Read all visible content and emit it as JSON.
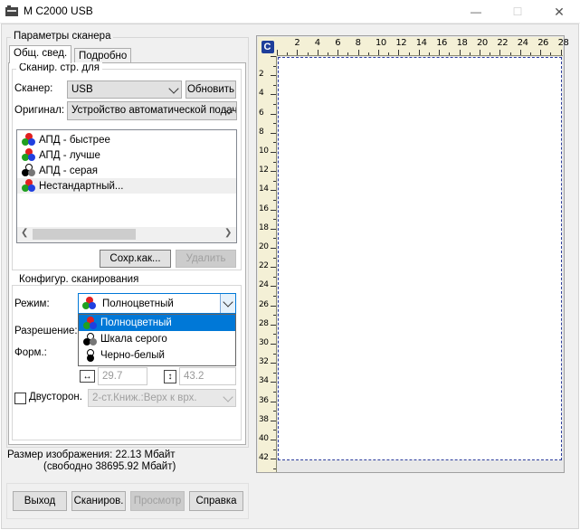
{
  "window": {
    "title": "M C2000 USB",
    "controls": {
      "minimize": "—",
      "maximize": "☐",
      "close": "✕"
    }
  },
  "scanner_params": {
    "group_label": "Параметры сканера",
    "tabs": [
      {
        "label": "Общ. свед.",
        "active": true
      },
      {
        "label": "Подробно",
        "active": false
      }
    ]
  },
  "scan_page": {
    "group_label": "Сканир. стр. для",
    "scanner_label": "Сканер:",
    "scanner_value": "USB",
    "refresh_label": "Обновить",
    "original_label": "Оригинал:",
    "original_value": "Устройство автоматической подачи",
    "presets": [
      {
        "label": "АПД - быстрее",
        "icon": "color-mode-icon"
      },
      {
        "label": "АПД - лучше",
        "icon": "color-mode-icon"
      },
      {
        "label": "АПД - серая",
        "icon": "grayscale-mode-icon"
      },
      {
        "label": "Нестандартный...",
        "icon": "color-mode-icon",
        "selected": true
      }
    ],
    "save_as_label": "Сохр.как...",
    "delete_label": "Удалить"
  },
  "scan_config": {
    "group_label": "Конфигур. сканирования",
    "mode_label": "Режим:",
    "mode_value": "Полноцветный",
    "resolution_label": "Разрешение:",
    "format_label": "Форм.:",
    "mode_options": [
      {
        "label": "Полноцветный",
        "icon": "color-mode-icon",
        "highlighted": true
      },
      {
        "label": "Шкала серого",
        "icon": "grayscale-mode-icon"
      },
      {
        "label": "Черно-белый",
        "icon": "bw-mode-icon"
      }
    ],
    "width_value": "29.7",
    "height_value": "43.2",
    "duplex_label": "Двусторон.",
    "duplex_checked": false,
    "duplex_value": "2-ст.Книж.:Верх к врх."
  },
  "image_size": {
    "size_text": "Размер изображения: 22.13 Мбайт",
    "free_text": "(свободно 38695.92 Мбайт)"
  },
  "bottom_buttons": {
    "exit": "Выход",
    "scan": "Сканиров.",
    "preview": "Просмотр",
    "help": "Справка"
  },
  "preview_area": {
    "corner_label": "C",
    "top_ruler_labels": [
      "2",
      "4",
      "6",
      "8",
      "10",
      "12",
      "14",
      "16",
      "18",
      "20",
      "22",
      "24",
      "26",
      "28"
    ],
    "left_ruler_labels": [
      "2",
      "4",
      "6",
      "8",
      "10",
      "12",
      "14",
      "16",
      "18",
      "20",
      "22",
      "24",
      "26",
      "28",
      "30",
      "32",
      "34",
      "36",
      "38",
      "40",
      "42"
    ]
  },
  "colors": {
    "selection": "#0078d7",
    "ruler_bg": "#f4f0d6",
    "page_border": "#2b3c9c"
  }
}
